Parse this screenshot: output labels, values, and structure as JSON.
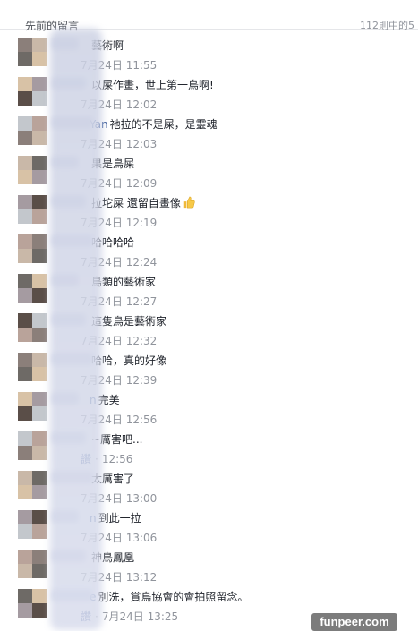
{
  "header": {
    "title": "先前的留言",
    "count": "112則中的5"
  },
  "comments": [
    {
      "name": "",
      "text": "藝術啊",
      "meta": "7月24日 11:55"
    },
    {
      "name": "",
      "text": "以屎作畫，世上第一鳥啊!",
      "meta": "7月24日 12:02"
    },
    {
      "name": "Yan",
      "text": "祂拉的不是屎，是靈魂",
      "meta": "7月24日 12:03"
    },
    {
      "name": "",
      "text": "果是鳥屎",
      "meta": "7月24日 12:09"
    },
    {
      "name": "",
      "text": "拉坨屎 還留自畫像",
      "meta": "7月24日 12:19"
    },
    {
      "name": "",
      "text": "哈哈哈哈",
      "meta": "7月24日 12:24"
    },
    {
      "name": "",
      "text": "鳥類的藝術家",
      "meta": "7月24日 12:27"
    },
    {
      "name": "",
      "text": "這隻鳥是藝術家",
      "meta": "7月24日 12:32"
    },
    {
      "name": "",
      "text": "哈哈，真的好像",
      "meta": "7月24日 12:39"
    },
    {
      "name": "n",
      "text": "完美",
      "meta": "7月24日 12:56"
    },
    {
      "name": "",
      "text": "~厲害吧...",
      "meta": "12:56",
      "like": "讚"
    },
    {
      "name": "",
      "text": "太厲害了",
      "meta": "7月24日 13:00"
    },
    {
      "name": "n",
      "text": "到此一拉",
      "meta": "7月24日 13:06"
    },
    {
      "name": "",
      "text": "神鳥鳳凰",
      "meta": "7月24日 13:12"
    },
    {
      "name": "e",
      "text": "別洗，賞鳥協會的會拍照留念。",
      "meta": "7月24日 13:25",
      "like": "讚"
    }
  ],
  "icons": {
    "thumb": "thumbs-up-icon"
  },
  "watermark": "funpeer.com",
  "colors": {
    "link": "#365899",
    "meta": "#90949c",
    "text": "#1d2129",
    "avatar_palette": [
      "#b9a39a",
      "#8b7f7a",
      "#c9b8a8",
      "#6e6a66",
      "#d8c2a6",
      "#a59ba1",
      "#5a4e48",
      "#c3c7cc"
    ]
  }
}
